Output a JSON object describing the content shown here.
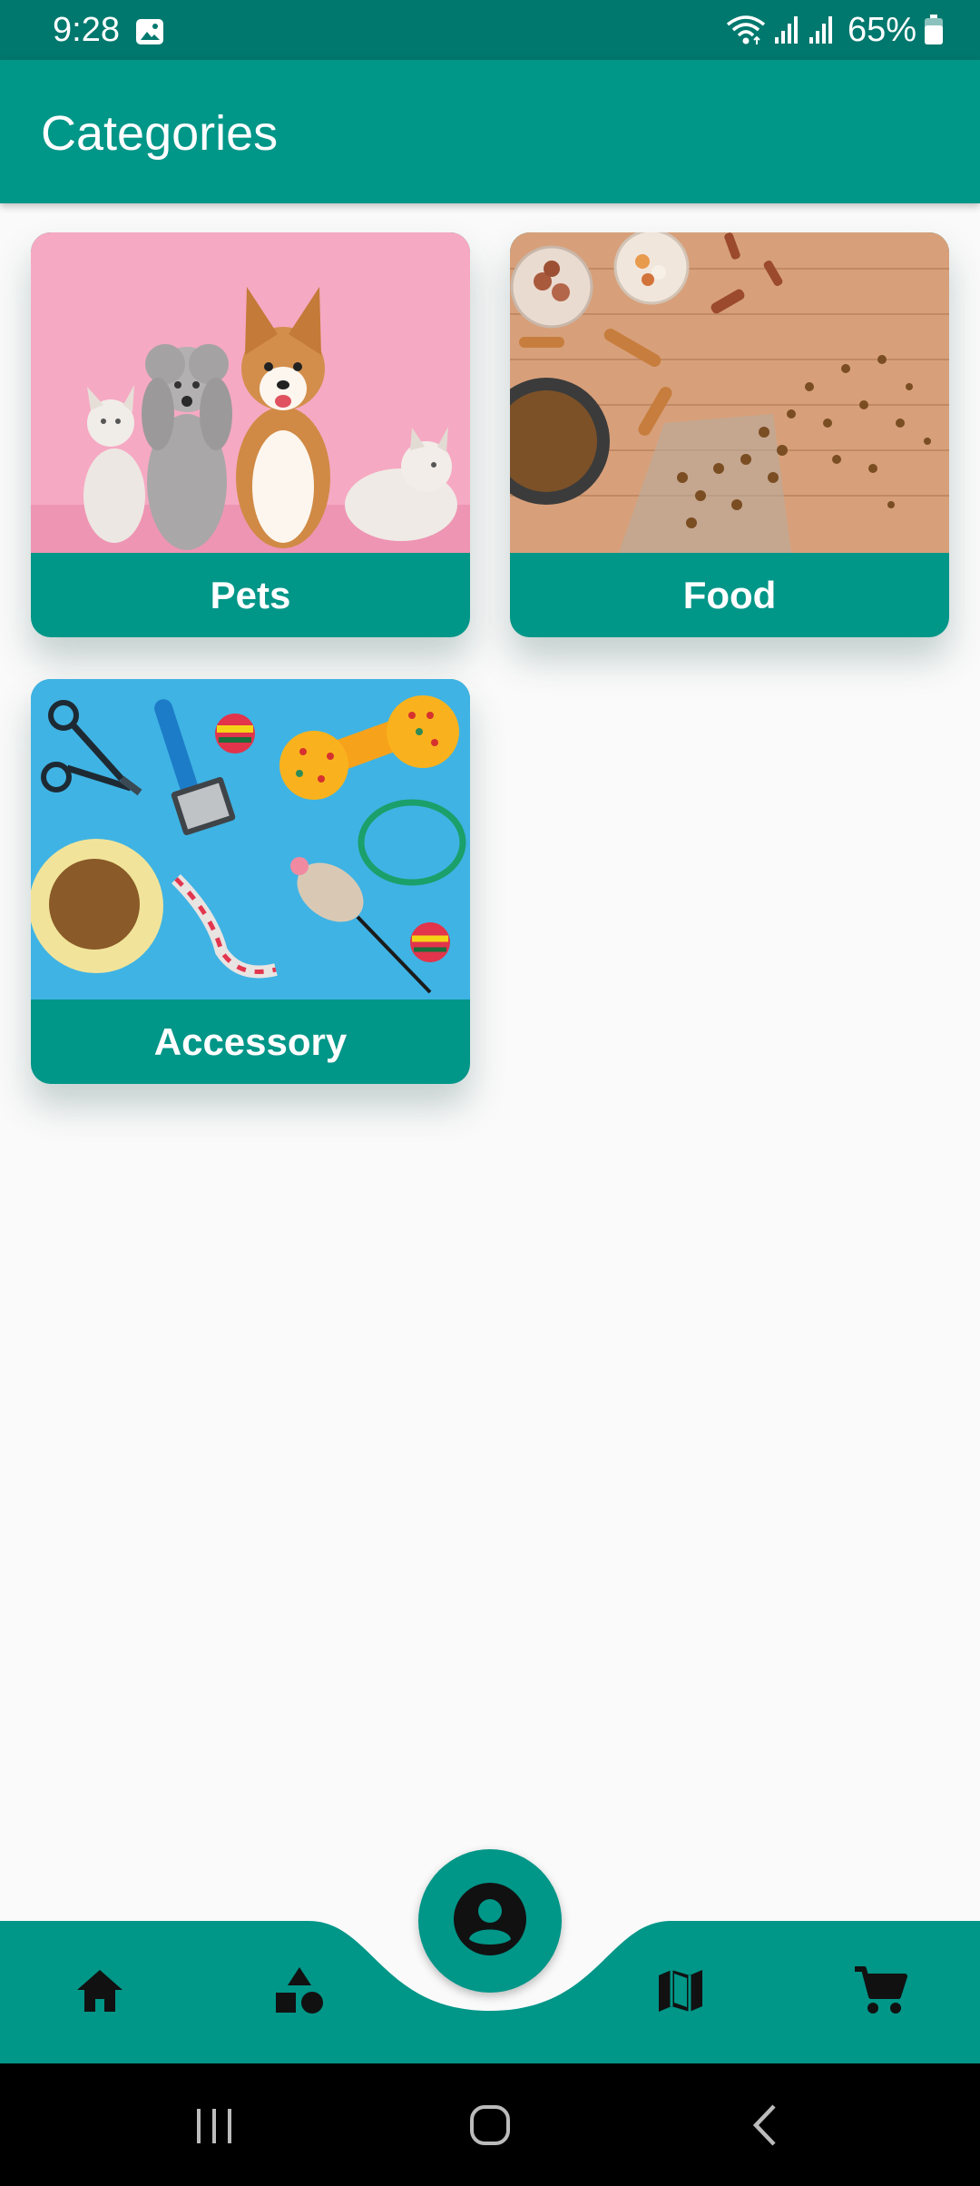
{
  "status_bar": {
    "time": "9:28",
    "battery_percent": "65%",
    "icons": [
      "gallery-icon",
      "wifi-icon",
      "signal-icon",
      "signal-icon",
      "battery-icon"
    ]
  },
  "app_bar": {
    "title": "Categories"
  },
  "categories": [
    {
      "label": "Pets",
      "image": "pets-photo"
    },
    {
      "label": "Food",
      "image": "pet-food-photo"
    },
    {
      "label": "Accessory",
      "image": "pet-accessories-photo"
    }
  ],
  "bottom_nav": {
    "items": [
      "home-icon",
      "categories-icon",
      "profile-icon",
      "map-icon",
      "cart-icon"
    ],
    "active": "profile-icon"
  },
  "system_nav": [
    "recents-icon",
    "home-icon",
    "back-icon"
  ],
  "colors": {
    "primary": "#009688",
    "primary_dark": "#00786e",
    "background": "#fafafa"
  }
}
